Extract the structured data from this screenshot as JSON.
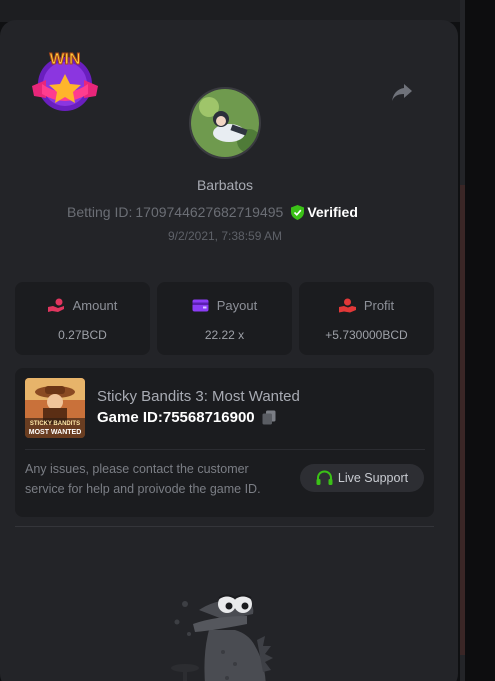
{
  "user": {
    "name": "Barbatos",
    "betting_id_label": "Betting ID:",
    "betting_id": "1709744627682719495",
    "verified_label": "Verified",
    "timestamp": "9/2/2021, 7:38:59 AM"
  },
  "badge": {
    "text": "WIN"
  },
  "stats": {
    "amount": {
      "label": "Amount",
      "value": "0.27BCD",
      "icon": "coins-hand-icon"
    },
    "payout": {
      "label": "Payout",
      "value": "22.22 x",
      "icon": "wallet-icon"
    },
    "profit": {
      "label": "Profit",
      "value": "+5.730000BCD",
      "icon": "profit-hand-icon"
    }
  },
  "game": {
    "title": "Sticky Bandits 3: Most Wanted",
    "id_label": "Game ID:",
    "id_value": "75568716900",
    "thumb_text_1": "STICKY BANDITS",
    "thumb_text_2": "MOST WANTED"
  },
  "support": {
    "text": "Any issues, please contact the customer service for help and proivode the game ID.",
    "button_label": "Live Support"
  },
  "colors": {
    "panel_bg": "#232428",
    "card_bg": "#1b1c1f",
    "verified_green": "#3bc117",
    "amount_icon": "#e0365f",
    "payout_icon": "#8b3cf5",
    "profit_icon": "#e23838",
    "support_icon": "#3bc117"
  }
}
